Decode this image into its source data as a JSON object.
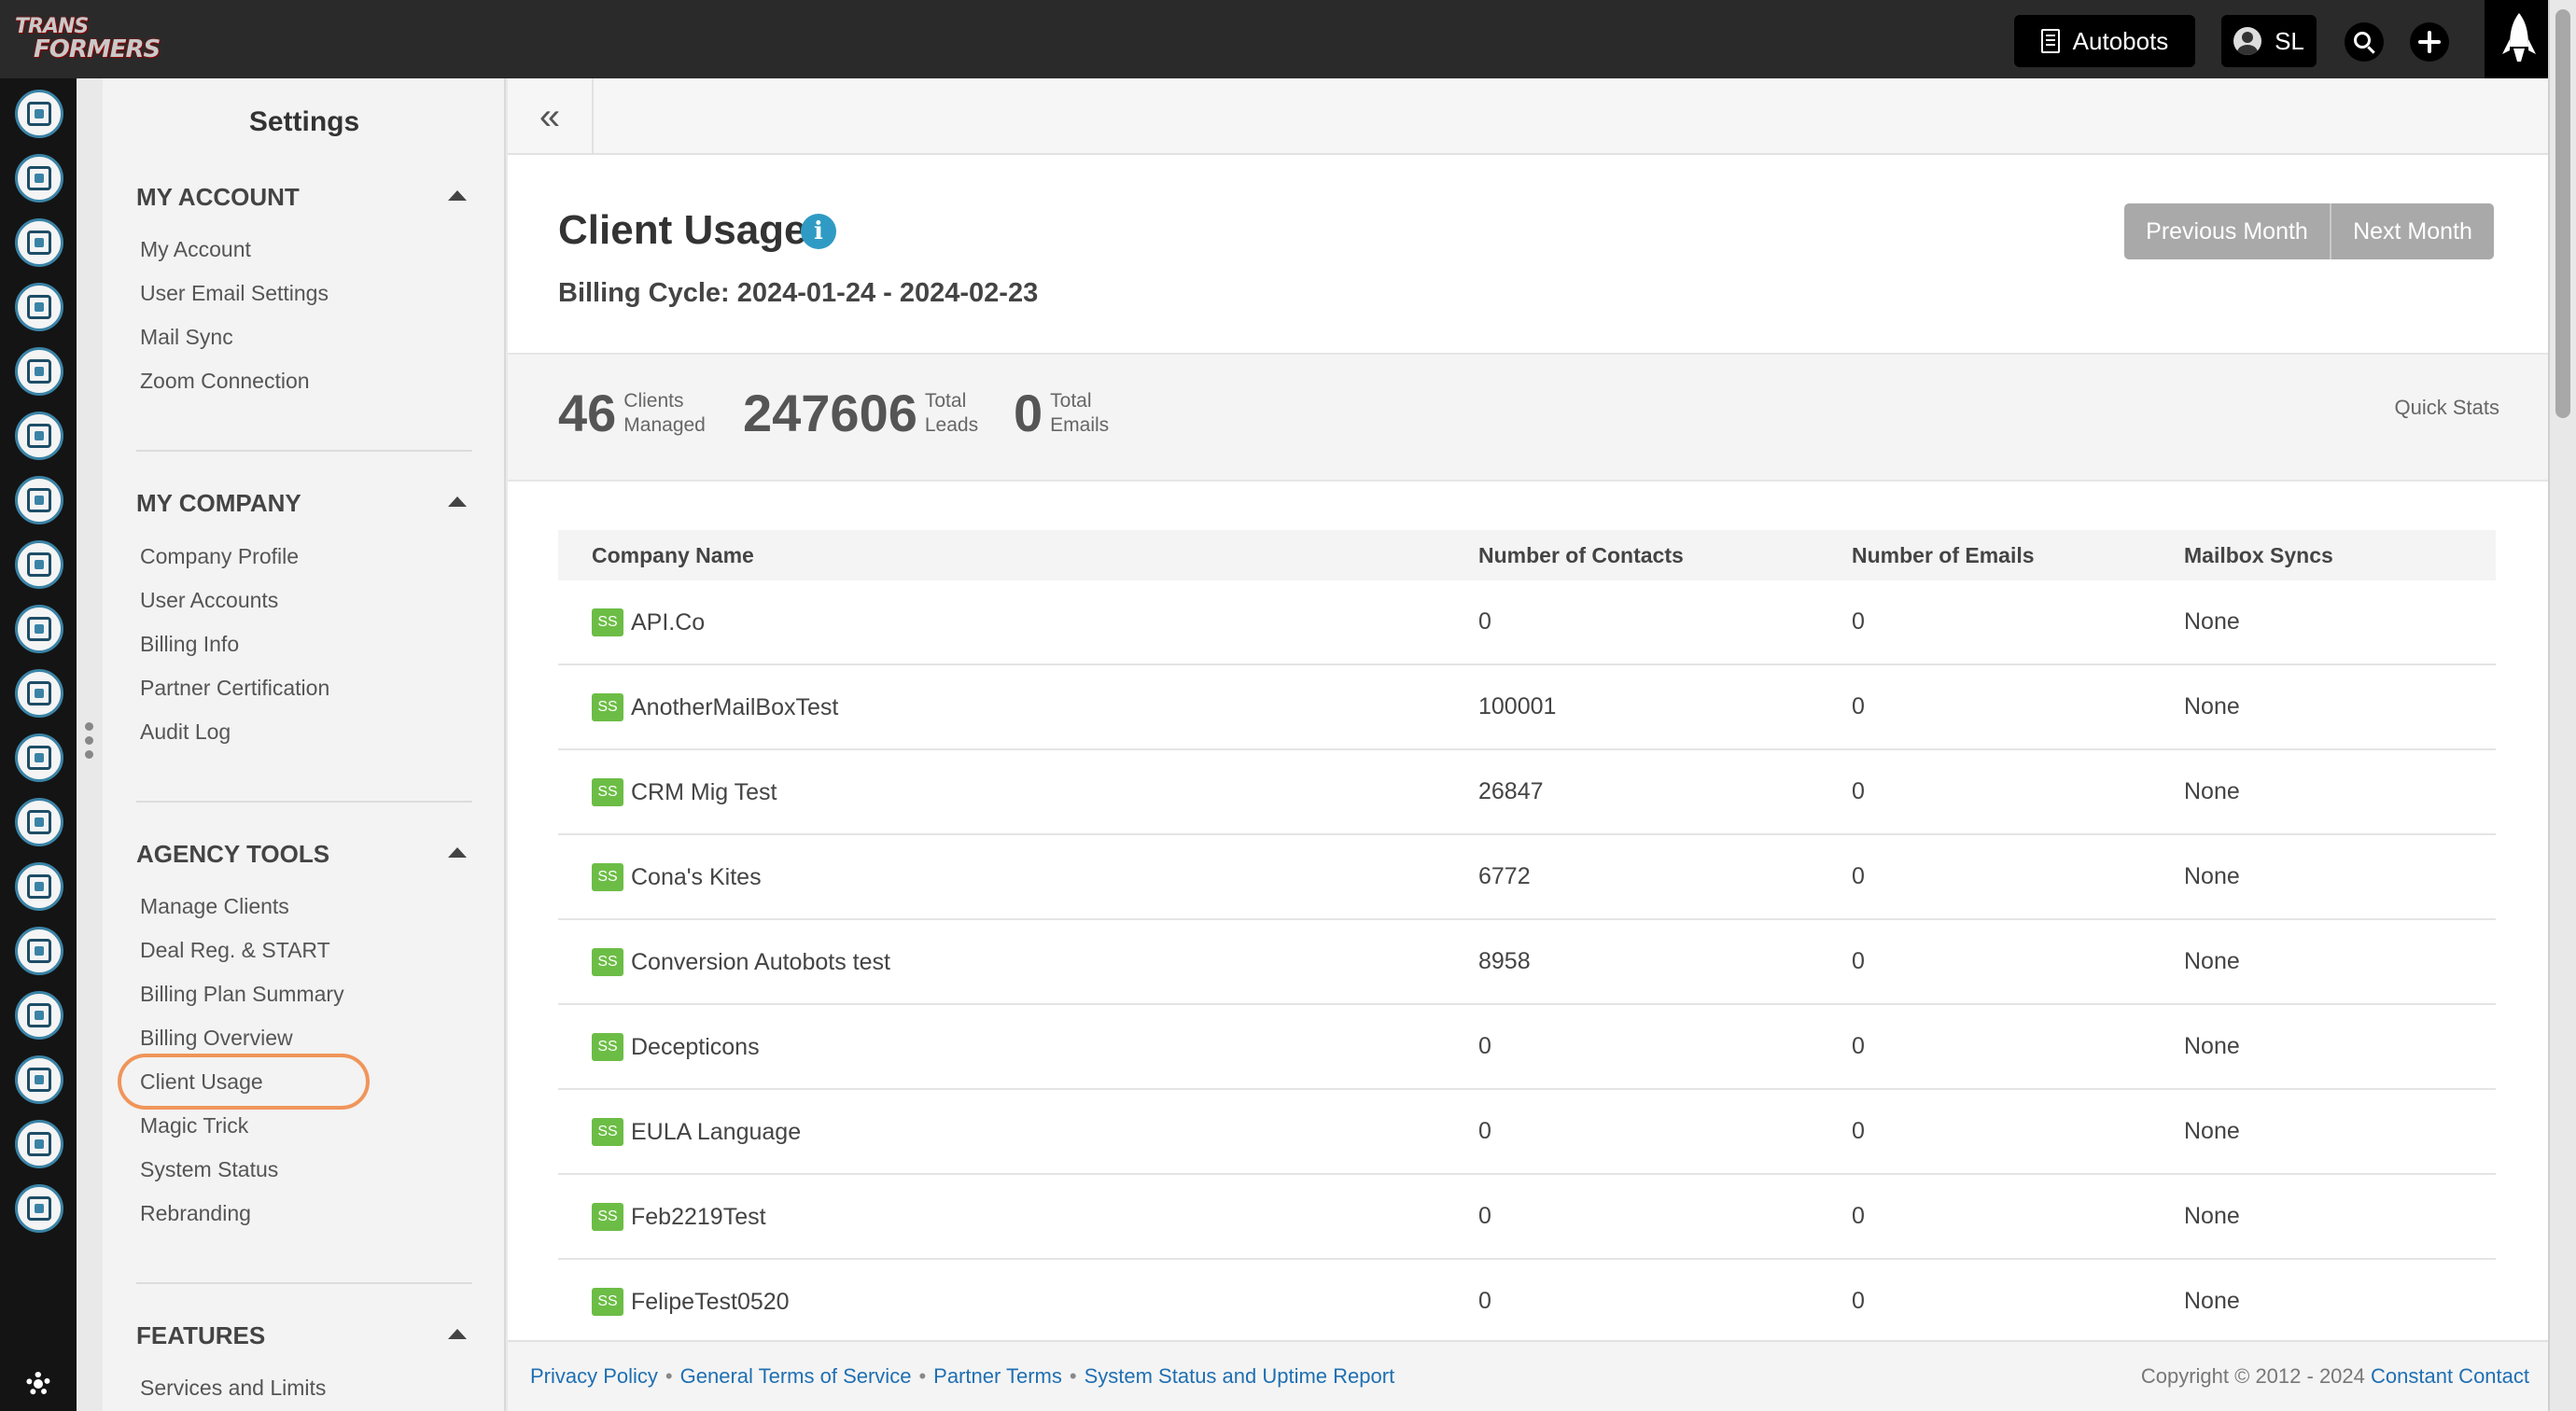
{
  "app": {
    "logo_line1": "TRANS",
    "logo_line2": "FORMERS",
    "org_button": "Autobots",
    "user_initials": "SL"
  },
  "rail": {
    "icons": [
      "contacts-icon",
      "email-icon",
      "clipboard-icon",
      "map-icon",
      "branch-icon",
      "list-icon",
      "megaphone-icon",
      "chat-icon",
      "thumbs-up-icon",
      "tv-icon",
      "image-icon",
      "calendar-icon",
      "handshake-icon",
      "growth-chart-icon",
      "headset-icon",
      "user-star-icon",
      "bar-chart-icon",
      "plug-icon"
    ]
  },
  "settings": {
    "title": "Settings",
    "sections": [
      {
        "name": "MY ACCOUNT",
        "items": [
          "My Account",
          "User Email Settings",
          "Mail Sync",
          "Zoom Connection"
        ]
      },
      {
        "name": "MY COMPANY",
        "items": [
          "Company Profile",
          "User Accounts",
          "Billing Info",
          "Partner Certification",
          "Audit Log"
        ]
      },
      {
        "name": "AGENCY TOOLS",
        "items": [
          "Manage Clients",
          "Deal Reg. & START",
          "Billing Plan Summary",
          "Billing Overview",
          "Client Usage",
          "Magic Trick",
          "System Status",
          "Rebranding"
        ]
      },
      {
        "name": "FEATURES",
        "items": [
          "Services and Limits"
        ]
      }
    ]
  },
  "page": {
    "title": "Client Usage",
    "billing_cycle": "Billing Cycle: 2024-01-24 - 2024-02-23",
    "prev_month": "Previous Month",
    "next_month": "Next Month",
    "collapse": "«"
  },
  "stats": [
    {
      "value": "46",
      "label1": "Clients",
      "label2": "Managed"
    },
    {
      "value": "247606",
      "label1": "Total",
      "label2": "Leads"
    },
    {
      "value": "0",
      "label1": "Total",
      "label2": "Emails"
    }
  ],
  "quick_stats": "Quick Stats",
  "table": {
    "columns": [
      "Company Name",
      "Number of Contacts",
      "Number of Emails",
      "Mailbox Syncs"
    ],
    "badge": "SS",
    "rows": [
      {
        "name": "API.Co",
        "contacts": "0",
        "emails": "0",
        "syncs": "None"
      },
      {
        "name": "AnotherMailBoxTest",
        "contacts": "100001",
        "emails": "0",
        "syncs": "None"
      },
      {
        "name": "CRM Mig Test",
        "contacts": "26847",
        "emails": "0",
        "syncs": "None"
      },
      {
        "name": "Cona's Kites",
        "contacts": "6772",
        "emails": "0",
        "syncs": "None"
      },
      {
        "name": "Conversion Autobots test",
        "contacts": "8958",
        "emails": "0",
        "syncs": "None"
      },
      {
        "name": "Decepticons",
        "contacts": "0",
        "emails": "0",
        "syncs": "None"
      },
      {
        "name": "EULA Language",
        "contacts": "0",
        "emails": "0",
        "syncs": "None"
      },
      {
        "name": "Feb2219Test",
        "contacts": "0",
        "emails": "0",
        "syncs": "None"
      },
      {
        "name": "FelipeTest0520",
        "contacts": "0",
        "emails": "0",
        "syncs": "None"
      }
    ]
  },
  "footer": {
    "links": [
      "Privacy Policy",
      "General Terms of Service",
      "Partner Terms",
      "System Status and Uptime Report"
    ],
    "separator": "•",
    "copyright": "Copyright © 2012 - 2024",
    "company": "Constant Contact"
  },
  "colors": {
    "accent_blue": "#2f9bc4",
    "badge_green": "#6cbd45",
    "highlight_orange": "#f0955a",
    "link_blue": "#1f6fb2"
  }
}
